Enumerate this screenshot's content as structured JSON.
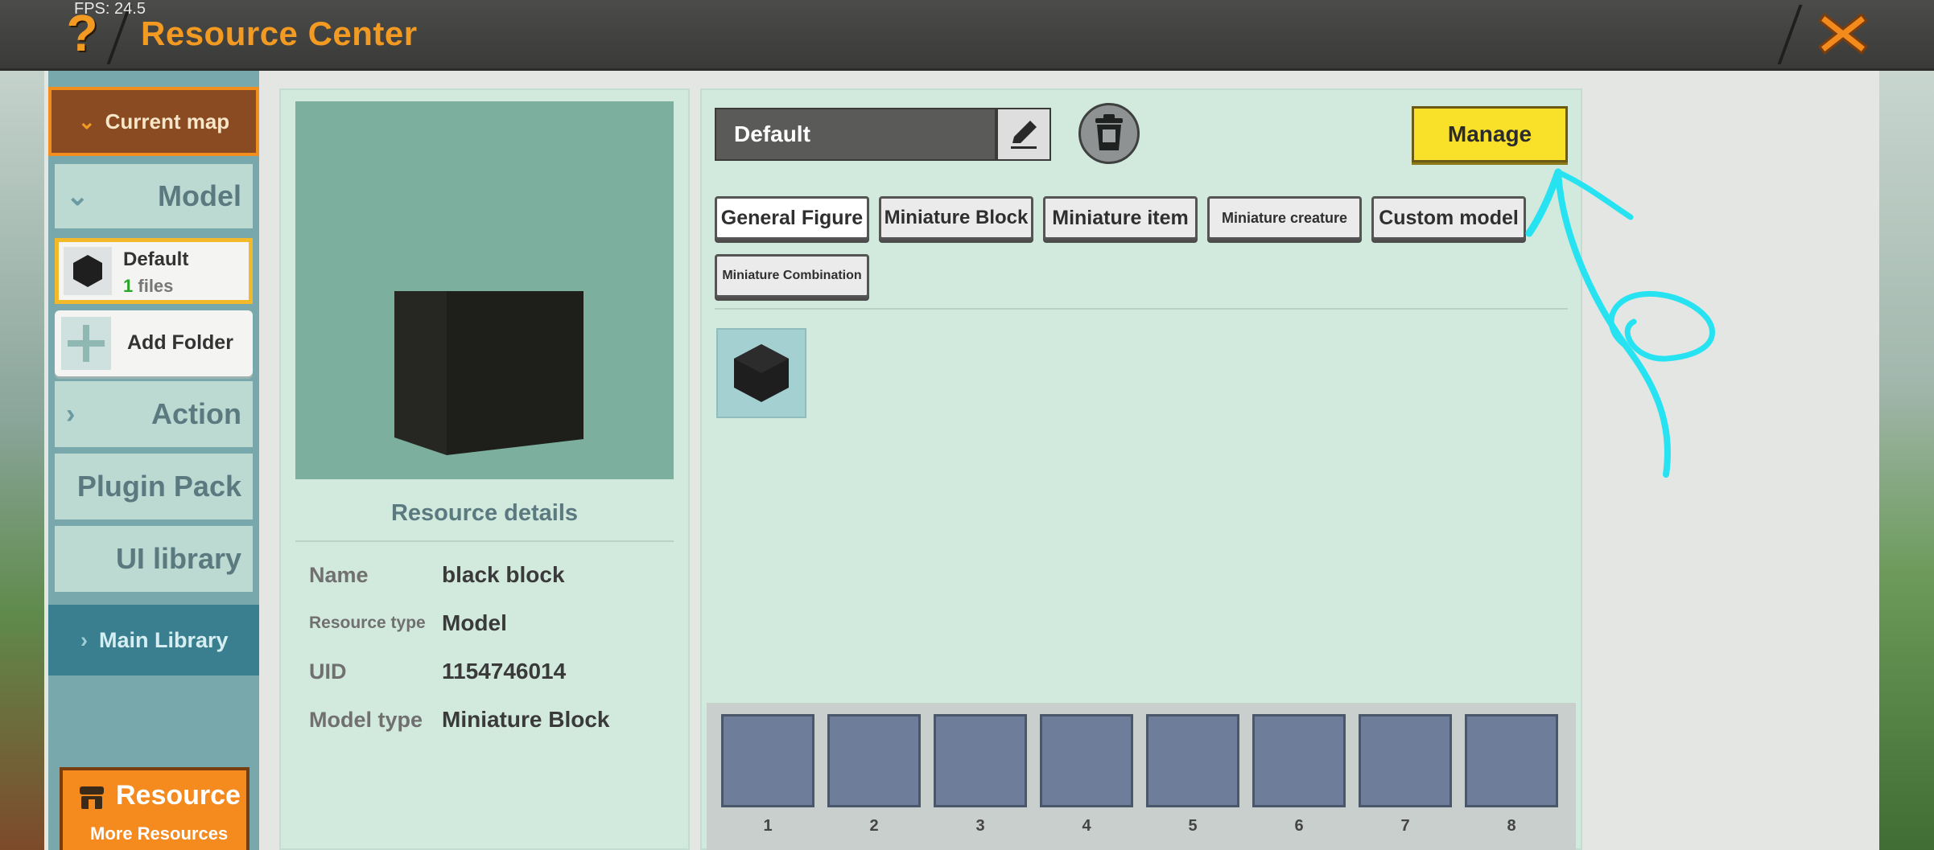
{
  "header": {
    "fps": "FPS: 24.5",
    "title": "Resource Center",
    "help_icon": "question-mark-icon",
    "close_icon": "close-x-icon"
  },
  "sidebar": {
    "current_map": "Current map",
    "model": "Model",
    "folder": {
      "name": "Default",
      "count": "1",
      "files_word": "files"
    },
    "add_folder": "Add Folder",
    "action": "Action",
    "plugin_pack": "Plugin Pack",
    "ui_library": "UI library",
    "main_library": "Main Library",
    "resource_btn": {
      "title": "Resource",
      "subtitle": "More Resources"
    }
  },
  "details": {
    "title": "Resource details",
    "rows": [
      {
        "label": "Name",
        "value": "black block"
      },
      {
        "label": "Resource type",
        "value": "Model"
      },
      {
        "label": "UID",
        "value": "1154746014"
      },
      {
        "label": "Model type",
        "value": "Miniature Block"
      }
    ]
  },
  "library": {
    "folder_name": "Default",
    "manage": "Manage",
    "tabs": [
      {
        "label": "General Figure",
        "active": true
      },
      {
        "label": "Miniature Block",
        "active": false
      },
      {
        "label": "Miniature item",
        "active": false
      },
      {
        "label": "Miniature creature",
        "active": false
      },
      {
        "label": "Custom model",
        "active": false
      },
      {
        "label": "Miniature Combination",
        "active": false
      }
    ]
  },
  "hotbar": {
    "slots": [
      "1",
      "2",
      "3",
      "4",
      "5",
      "6",
      "7",
      "8"
    ]
  },
  "colors": {
    "accent_orange": "#f39a22",
    "manage_yellow": "#f9e12a",
    "panel_green": "#d2e9de",
    "sidebar_teal": "#78a8ab",
    "annotation_cyan": "#27e3f2"
  }
}
